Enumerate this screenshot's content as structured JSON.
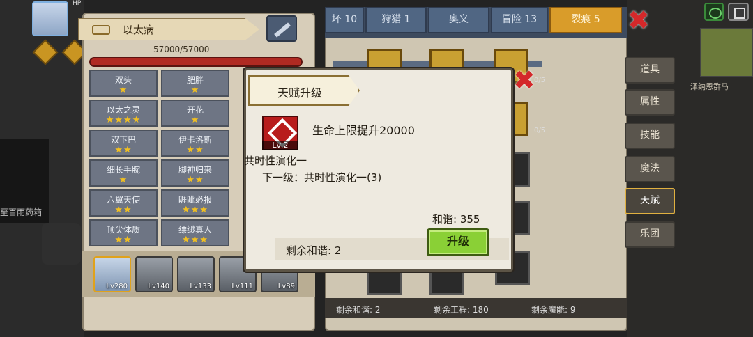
{
  "hud": {
    "hp_tag": "HP"
  },
  "map": {
    "label": "泽纳恩群马"
  },
  "left_side": {
    "label": "至百雨药箱"
  },
  "left_panel": {
    "title": "以太病",
    "hp": "57000/57000",
    "talents": [
      {
        "name": "双头",
        "stars": "★"
      },
      {
        "name": "肥胖",
        "stars": "★"
      },
      {
        "name": "以太之灵",
        "stars": "★★★★"
      },
      {
        "name": "开花",
        "stars": "★"
      },
      {
        "name": "双下巴",
        "stars": "★★"
      },
      {
        "name": "伊卡洛斯",
        "stars": "★★"
      },
      {
        "name": "细长手腕",
        "stars": "★"
      },
      {
        "name": "脚神归来",
        "stars": "★★"
      },
      {
        "name": "六翼天使",
        "stars": "★★"
      },
      {
        "name": "睚眦必报",
        "stars": "★★★"
      },
      {
        "name": "顶尖体质",
        "stars": "★★"
      },
      {
        "name": "缥缈真人",
        "stars": "★★★"
      }
    ],
    "characters": [
      "Lv280",
      "Lv140",
      "Lv133",
      "Lv111",
      "Lv89"
    ]
  },
  "right_panel": {
    "tabs": [
      "坏 10",
      "狩猎 1",
      "奥义",
      "冒险 13",
      "裂痕 5"
    ],
    "node_counts": [
      "0/5",
      "0/5"
    ],
    "side_menu": [
      "道具",
      "属性",
      "技能",
      "魔法",
      "天赋",
      "乐团"
    ],
    "active_menu": "天赋",
    "bottom": {
      "harmony": "剩余和谐: 2",
      "engineering": "剩余工程: 180",
      "magic": "剩余魔能: 9"
    }
  },
  "dialog": {
    "title": "天赋升级",
    "icon_level": "Lv 2",
    "description": "生命上限提升20000",
    "name": "共时性演化一",
    "next_level": "下一级：共时性演化一(3)",
    "harmony_cost": "和谐: 355",
    "remaining": "剩余和谐: 2",
    "upgrade_label": "升级"
  }
}
